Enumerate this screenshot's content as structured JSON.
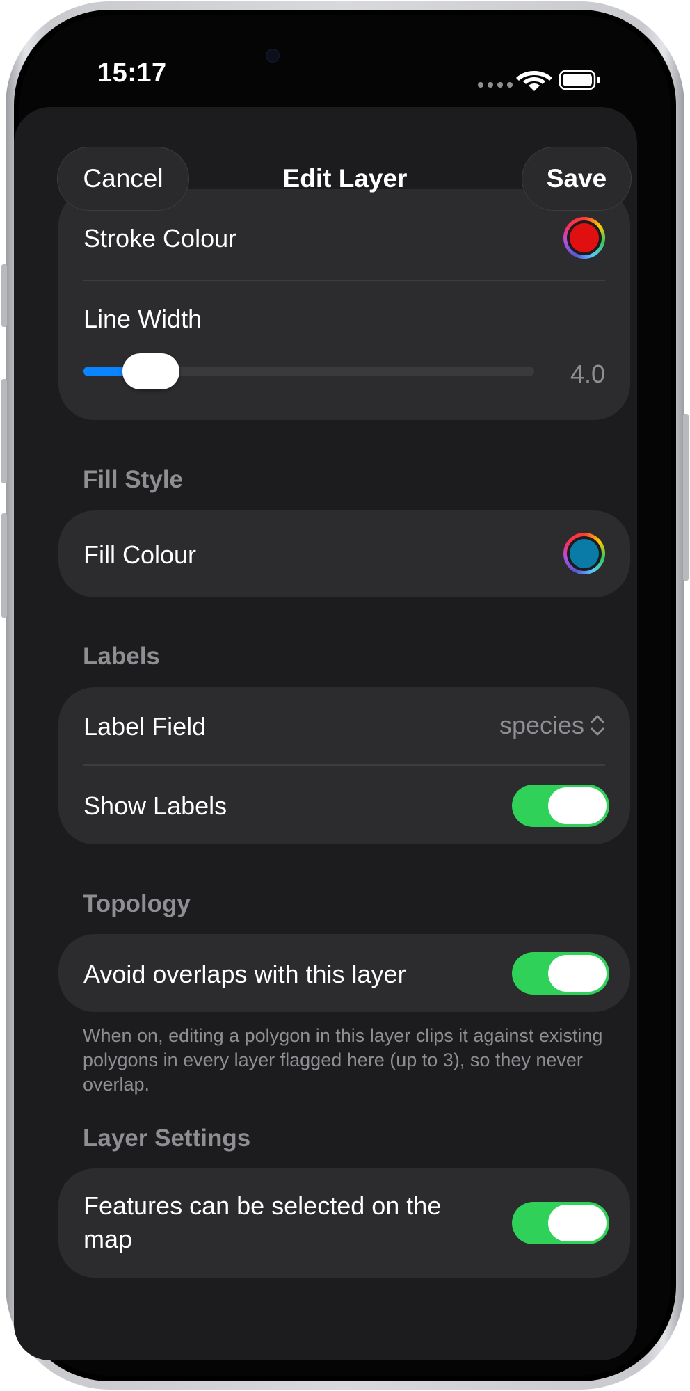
{
  "status_bar": {
    "time": "15:17"
  },
  "nav": {
    "cancel": "Cancel",
    "title": "Edit Layer",
    "save": "Save"
  },
  "stroke": {
    "colour_label": "Stroke Colour",
    "colour": "#e01010",
    "width_label": "Line Width",
    "width_value": "4.0",
    "width_fraction": 0.15
  },
  "fill_section": {
    "header": "Fill Style",
    "colour_label": "Fill Colour",
    "colour": "#0a7aa6"
  },
  "labels_section": {
    "header": "Labels",
    "field_label": "Label Field",
    "field_value": "species",
    "show_label": "Show Labels",
    "show_on": true
  },
  "topology_section": {
    "header": "Topology",
    "avoid_label": "Avoid overlaps with this layer",
    "avoid_on": true,
    "note": "When on, editing a polygon in this layer clips it against existing polygons in every layer flagged here (up to 3), so they never overlap."
  },
  "layer_settings": {
    "header": "Layer Settings",
    "selectable_label": "Features can be selected on the map",
    "selectable_on": true
  },
  "colors": {
    "accent": "#0a84ff",
    "toggle_on": "#30d158",
    "background": "#1c1c1e",
    "card": "#2c2c2e"
  },
  "icons": [
    "wifi-icon",
    "battery-icon",
    "signal-dots-icon",
    "chevron-up-down-icon"
  ]
}
